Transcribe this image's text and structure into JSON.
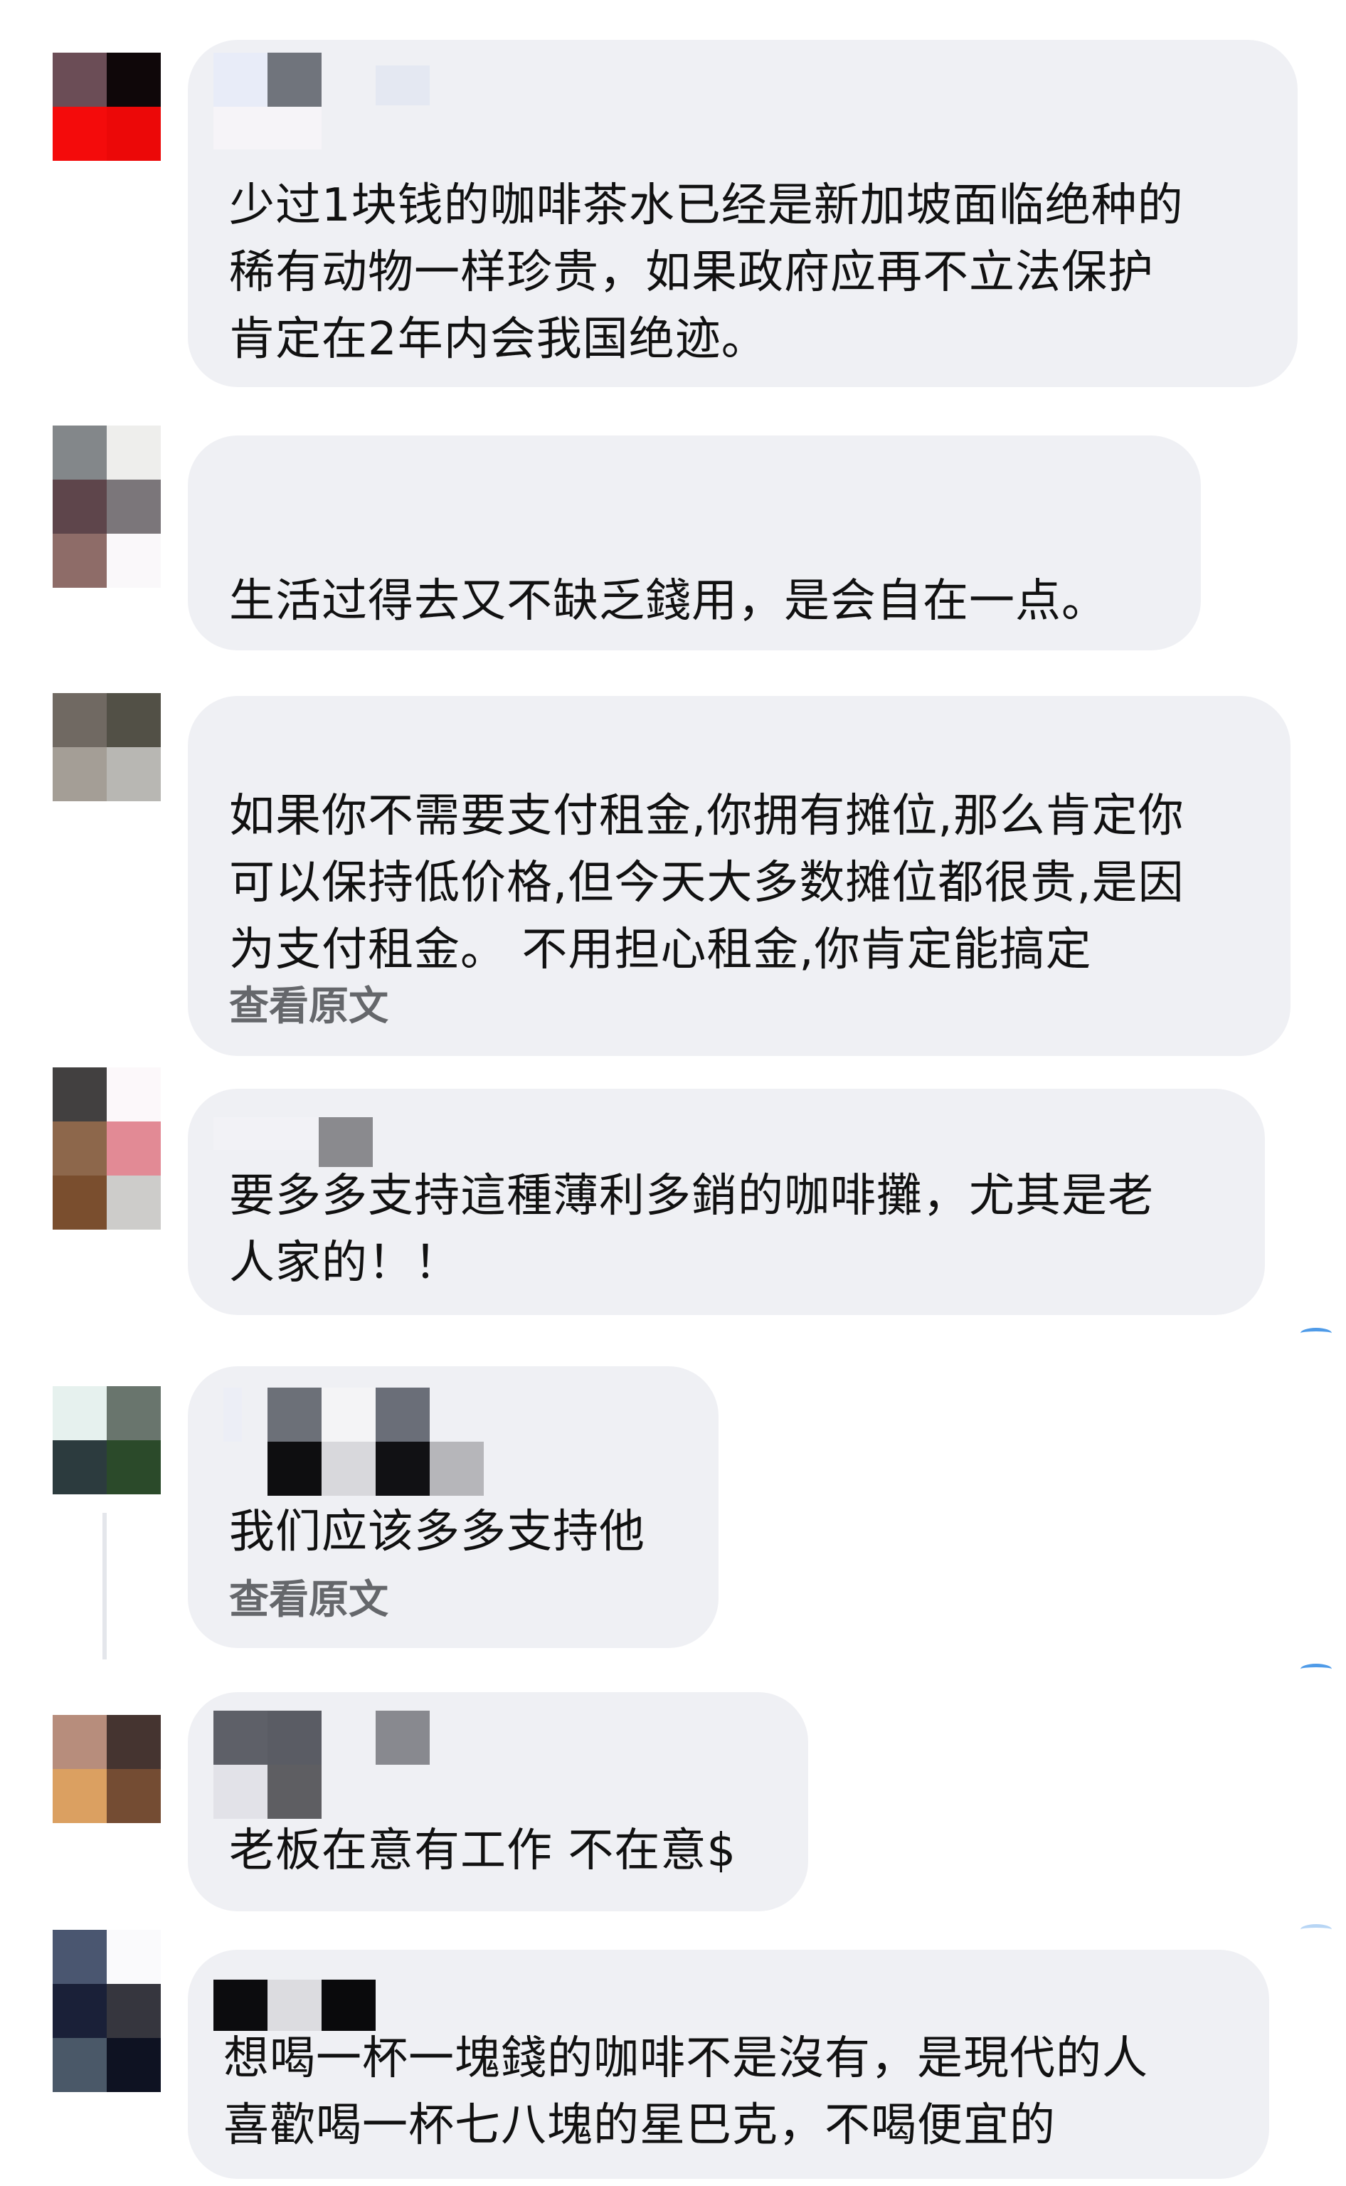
{
  "comments": [
    {
      "text": "少过1块钱的咖啡茶水已经是新加坡面临绝种的\n稀有动物一样珍贵，如果政府应再不立法保护\n肯定在2年内会我国绝迹。",
      "see_original": ""
    },
    {
      "text": "生活过得去又不缺乏錢用，是会自在一点。",
      "see_original": ""
    },
    {
      "text": "如果你不需要支付租金,你拥有摊位,那么肯定你\n可以保持低价格,但今天大多数摊位都很贵,是因\n为支付租金。 不用担心租金,你肯定能搞定",
      "see_original": "查看原文"
    },
    {
      "text": "要多多支持這種薄利多銷的咖啡攤，尤其是老\n人家的！！",
      "see_original": ""
    },
    {
      "text": "我们应该多多支持他",
      "see_original": "查看原文"
    },
    {
      "text": "老板在意有工作 不在意$",
      "see_original": ""
    },
    {
      "text": "想喝一杯一塊錢的咖啡不是沒有，是現代的人\n喜歡喝一杯七八塊的星巴克，不喝便宜的",
      "see_original": ""
    }
  ],
  "colors": {
    "bubble": "#eff0f4",
    "text": "#111111",
    "see_original": "#65676b"
  }
}
